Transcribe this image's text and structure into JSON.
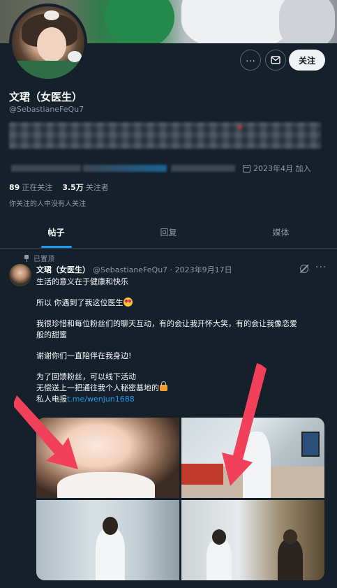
{
  "profile": {
    "name": "文珺（女医生）",
    "handle": "@SebastianeFeQu7",
    "joined": "2023年4月 加入",
    "following_count": "89",
    "following_label": "正在关注",
    "followers_count": "3.5万",
    "followers_label": "关注者",
    "mutual_note": "你关注的人中没有人关注"
  },
  "actions": {
    "more": "···",
    "follow": "关注"
  },
  "tabs": [
    {
      "label": "帖子",
      "active": true
    },
    {
      "label": "回复",
      "active": false
    },
    {
      "label": "媒体",
      "active": false
    }
  ],
  "post": {
    "pinned_label": "已置顶",
    "author_name": "文珺（女医生）",
    "author_handle_date": "@SebastianeFeQu7 · 2023年9月17日",
    "more": "···",
    "lines": {
      "l1": "生活的意义在于健康和快乐",
      "l2": "所以 你遇到了我这位医生",
      "l3a": "我很珍惜和每位粉丝们的聊天互动，有的会让我开怀大笑，有的会让我像恋爱",
      "l3b": "般的甜蜜",
      "l4": "谢谢你们一直陪伴在我身边!",
      "l5a": "为了回馈粉丝，可以线下活动",
      "l5b": "无偿送上一把通往我个人秘密基地的",
      "l6_prefix": "私人电报",
      "l6_link": "t.me/wenjun1688"
    }
  },
  "colors": {
    "background": "#15202b",
    "text": "#f7f9f9",
    "muted": "#8b98a5",
    "accent": "#1d9bf0",
    "divider": "#38444d",
    "arrow": "#f0405a"
  },
  "icons": [
    "more-icon",
    "mail-icon",
    "calendar-icon",
    "pin-icon",
    "grok-icon",
    "star-eyes-emoji",
    "key-lock-emoji"
  ]
}
